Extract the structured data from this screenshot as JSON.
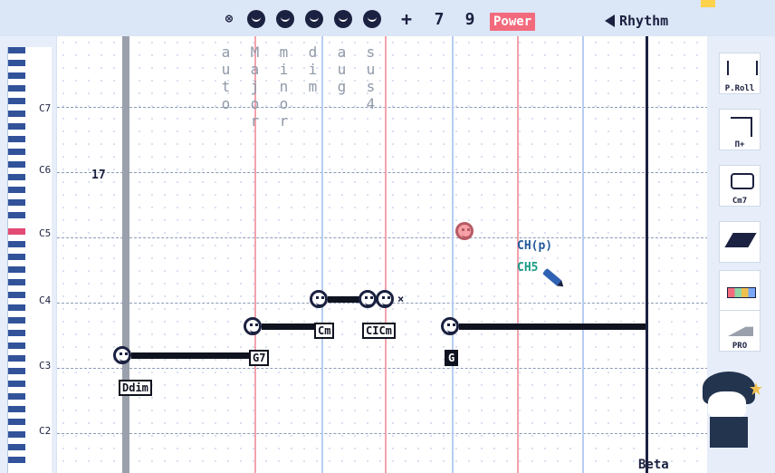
{
  "top": {
    "numbers": [
      "7",
      "9"
    ],
    "power": "Power",
    "rhythm": "Rhythm"
  },
  "piano_labels": [
    "C7",
    "C6",
    "C5",
    "C4",
    "C3",
    "C2"
  ],
  "chord_columns": [
    "auto",
    "Major",
    "minor",
    "dim",
    "aug",
    "sus4"
  ],
  "grid": {
    "bar_number": "17",
    "labels": {
      "g7": "G7",
      "ddim": "Ddim",
      "cm": "Cm",
      "cicm": "CICm",
      "g": "G"
    },
    "pink_note": {
      "ch_p": "CH(p)",
      "ch5": "CH5"
    }
  },
  "tools": [
    "P.Roll",
    "Π+",
    "Cm7",
    "",
    "",
    "PRO"
  ],
  "beta": "Beta",
  "colors": {
    "accent": "#f36a7d",
    "rail": "#4f77c4",
    "ink": "#1b2140"
  },
  "icons": [
    "close-icon",
    "face-icon",
    "face-icon",
    "face-icon",
    "face-icon",
    "face-icon",
    "plus-icon",
    "speaker-icon",
    "pencil-icon",
    "piano-roll-icon",
    "wave-icon",
    "chord-icon",
    "parallelogram-icon",
    "color-palette-icon",
    "pro-icon"
  ]
}
